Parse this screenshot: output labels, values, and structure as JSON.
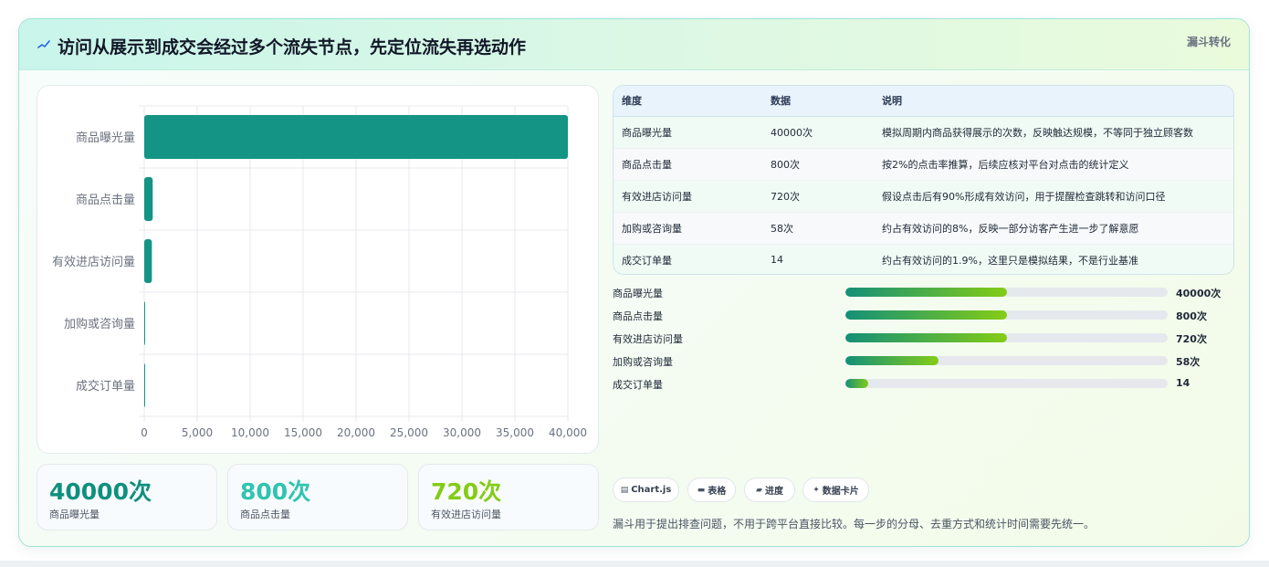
{
  "header": {
    "icon": "trend-line-icon",
    "title": "访问从展示到成交会经过多个流失节点，先定位流失再选动作",
    "tag": "漏斗转化"
  },
  "chart_data": {
    "type": "bar",
    "orientation": "horizontal",
    "categories": [
      "商品曝光量",
      "商品点击量",
      "有效进店访问量",
      "加购或咨询量",
      "成交订单量"
    ],
    "values": [
      40000,
      800,
      720,
      58,
      14
    ],
    "xlim": [
      0,
      40000
    ],
    "x_ticks": [
      0,
      5000,
      10000,
      15000,
      20000,
      25000,
      30000,
      35000,
      40000
    ],
    "x_tick_labels": [
      "0",
      "5,000",
      "10,000",
      "15,000",
      "20,000",
      "25,000",
      "30,000",
      "35,000",
      "40,000"
    ],
    "title": "",
    "xlabel": "",
    "ylabel": "",
    "grid": true,
    "bar_color": "#149485"
  },
  "stats": [
    {
      "value": "40000次",
      "label": "商品曝光量",
      "color": "#0f8f7e"
    },
    {
      "value": "800次",
      "label": "商品点击量",
      "color": "#2ec4b0"
    },
    {
      "value": "720次",
      "label": "有效进店访问量",
      "color": "#84cc16"
    }
  ],
  "table": {
    "headers": [
      "维度",
      "数据",
      "说明"
    ],
    "rows": [
      [
        "商品曝光量",
        "40000次",
        "模拟周期内商品获得展示的次数，反映触达规模，不等同于独立顾客数"
      ],
      [
        "商品点击量",
        "800次",
        "按2%的点击率推算，后续应核对平台对点击的统计定义"
      ],
      [
        "有效进店访问量",
        "720次",
        "假设点击后有90%形成有效访问，用于提醒检查跳转和访问口径"
      ],
      [
        "加购或咨询量",
        "58次",
        "约占有效访问的8%，反映一部分访客产生进一步了解意愿"
      ],
      [
        "成交订单量",
        "14",
        "约占有效访问的1.9%，这里只是模拟结果，不是行业基准"
      ]
    ]
  },
  "progress": [
    {
      "label": "商品曝光量",
      "value": "40000次",
      "fill": 0.5
    },
    {
      "label": "商品点击量",
      "value": "800次",
      "fill": 0.5
    },
    {
      "label": "有效进店访问量",
      "value": "720次",
      "fill": 0.5
    },
    {
      "label": "加购或咨询量",
      "value": "58次",
      "fill": 0.29
    },
    {
      "label": "成交订单量",
      "value": "14",
      "fill": 0.07
    }
  ],
  "chips": [
    {
      "icon": "chart-icon",
      "glyph": "▤",
      "label": "Chart.js"
    },
    {
      "icon": "table-icon",
      "glyph": "▬",
      "label": "表格"
    },
    {
      "icon": "progress-icon",
      "glyph": "▰",
      "label": "进度"
    },
    {
      "icon": "sparkle-icon",
      "glyph": "✦",
      "label": "数据卡片"
    }
  ],
  "footnote": "漏斗用于提出排查问题，不用于跨平台直接比较。每一步的分母、去重方式和统计时间需要先统一。"
}
